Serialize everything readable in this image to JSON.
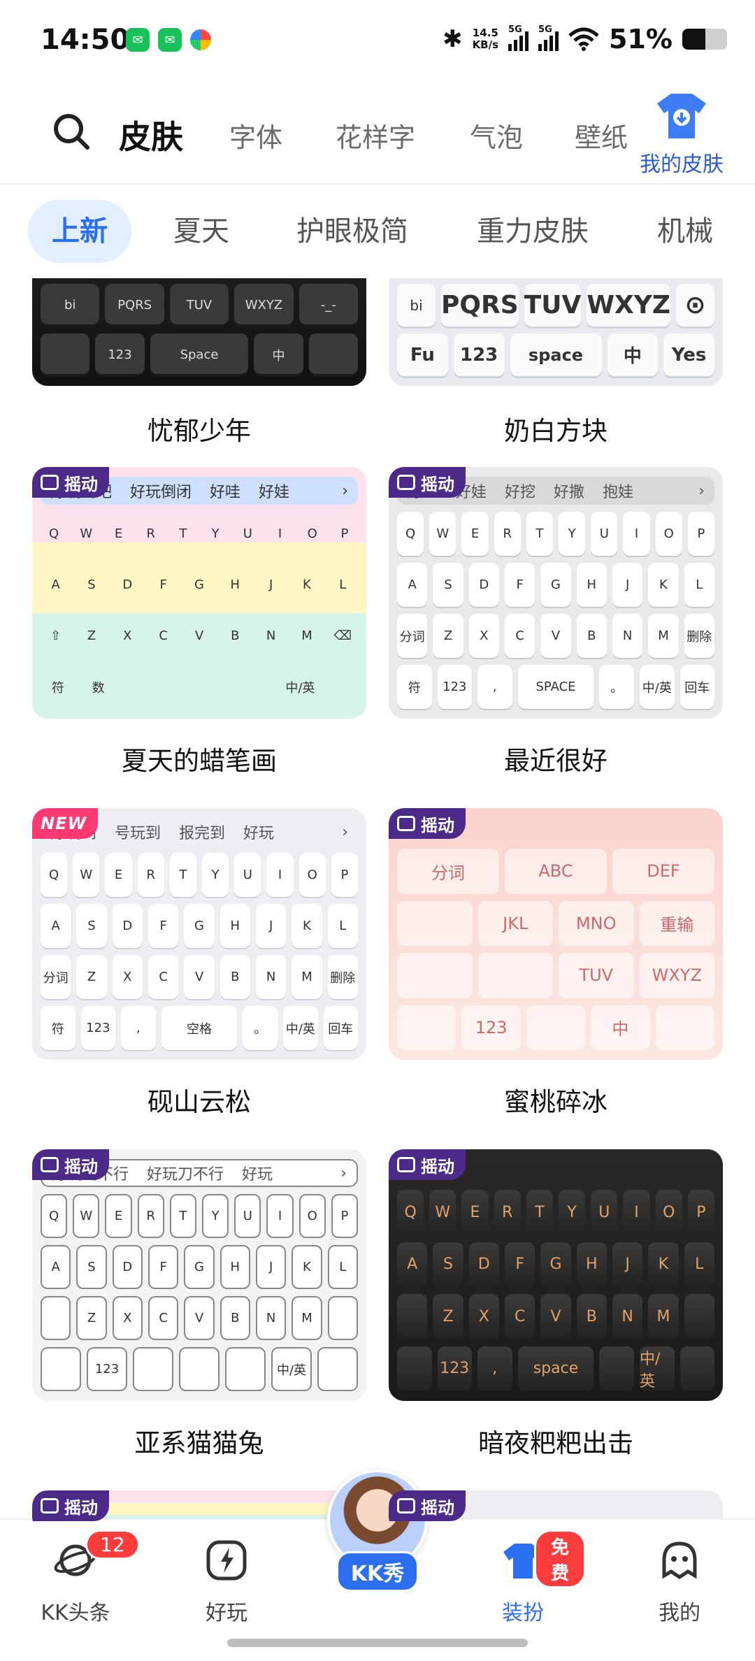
{
  "status_bar": {
    "time": "14:50",
    "app_icons": [
      "wechat-icon",
      "wechat-work-icon",
      "colorful-app-icon"
    ],
    "net_speed_value": "14.5",
    "net_speed_unit": "KB/s",
    "signal1_label": "5G",
    "signal2_label": "5G",
    "battery": "51%",
    "battery_level": 0.51
  },
  "top_tabs": [
    {
      "label": "皮肤",
      "active": true
    },
    {
      "label": "字体",
      "active": false
    },
    {
      "label": "花样字",
      "active": false
    },
    {
      "label": "气泡",
      "active": false
    },
    {
      "label": "壁纸",
      "active": false
    }
  ],
  "my_skin_label": "我的皮肤",
  "sub_tabs": [
    {
      "label": "上新",
      "active": true
    },
    {
      "label": "夏天",
      "active": false
    },
    {
      "label": "护眼极简",
      "active": false
    },
    {
      "label": "重力皮肤",
      "active": false
    },
    {
      "label": "机械",
      "active": false
    }
  ],
  "badges": {
    "shake": "摇动",
    "new": "NEW"
  },
  "cards": [
    {
      "title": "忧郁少年",
      "badge": "",
      "keys": [
        [
          "bi",
          "PQRS",
          "TUV",
          "WXYZ",
          "-_-"
        ],
        [
          "",
          "123",
          "Space",
          "中",
          ""
        ]
      ]
    },
    {
      "title": "奶白方块",
      "badge": "",
      "keys": [
        [
          "bi",
          "PQRS",
          "TUV",
          "WXYZ",
          "⊙"
        ],
        [
          "Fu",
          "123",
          "space",
          "中",
          "Yes"
        ]
      ]
    },
    {
      "title": "夏天的蜡笔画",
      "badge": "shake",
      "cands": [
        "好玩到吧",
        "好玩倒闭",
        "好哇",
        "好娃"
      ],
      "keys": [
        [
          "Q",
          "W",
          "E",
          "R",
          "T",
          "Y",
          "U",
          "I",
          "O",
          "P"
        ],
        [
          "A",
          "S",
          "D",
          "F",
          "G",
          "H",
          "J",
          "K",
          "L"
        ],
        [
          "⇧",
          "Z",
          "X",
          "C",
          "V",
          "B",
          "N",
          "M",
          "⌫"
        ],
        [
          "符",
          "数",
          "",
          "",
          "",
          "",
          "中/英",
          ""
        ]
      ]
    },
    {
      "title": "最近很好",
      "badge": "shake",
      "cands": [
        "好哇",
        "好娃",
        "好挖",
        "好撒",
        "抱娃"
      ],
      "keys": [
        [
          "Q",
          "W",
          "E",
          "R",
          "T",
          "Y",
          "U",
          "I",
          "O",
          "P"
        ],
        [
          "A",
          "S",
          "D",
          "F",
          "G",
          "H",
          "J",
          "K",
          "L"
        ],
        [
          "分词",
          "Z",
          "X",
          "C",
          "V",
          "B",
          "N",
          "M",
          "删除"
        ],
        [
          "符",
          "123",
          ",",
          "SPACE",
          "。",
          "中/英",
          "回车"
        ]
      ]
    },
    {
      "title": "砚山云松",
      "badge": "new",
      "cands": [
        "好玩到",
        "号玩到",
        "报完到",
        "好玩"
      ],
      "keys": [
        [
          "Q",
          "W",
          "E",
          "R",
          "T",
          "Y",
          "U",
          "I",
          "O",
          "P"
        ],
        [
          "A",
          "S",
          "D",
          "F",
          "G",
          "H",
          "J",
          "K",
          "L"
        ],
        [
          "分词",
          "Z",
          "X",
          "C",
          "V",
          "B",
          "N",
          "M",
          "删除"
        ],
        [
          "符",
          "123",
          ",",
          "空格",
          "。",
          "中/英",
          "回车"
        ]
      ]
    },
    {
      "title": "蜜桃碎冰",
      "badge": "shake",
      "keys": [
        [
          "分词",
          "ABC",
          "DEF"
        ],
        [
          "",
          "JKL",
          "MNO",
          "重输"
        ],
        [
          "",
          "",
          "TUV",
          "WXYZ"
        ],
        [
          "",
          "123",
          "",
          "中",
          ""
        ]
      ]
    },
    {
      "title": "亚系猫猫兔",
      "badge": "shake",
      "cands": [
        "好玩到不行",
        "好玩刀不行",
        "好玩"
      ],
      "keys": [
        [
          "Q",
          "W",
          "E",
          "R",
          "T",
          "Y",
          "U",
          "I",
          "O",
          "P"
        ],
        [
          "A",
          "S",
          "D",
          "F",
          "G",
          "H",
          "J",
          "K",
          "L"
        ],
        [
          "",
          "Z",
          "X",
          "C",
          "V",
          "B",
          "N",
          "M",
          ""
        ],
        [
          "",
          "123",
          "",
          "",
          "",
          "中/英",
          ""
        ]
      ]
    },
    {
      "title": "暗夜粑粑出击",
      "badge": "shake",
      "keys": [
        [
          "Q",
          "W",
          "E",
          "R",
          "T",
          "Y",
          "U",
          "I",
          "O",
          "P"
        ],
        [
          "A",
          "S",
          "D",
          "F",
          "G",
          "H",
          "J",
          "K",
          "L"
        ],
        [
          "",
          "Z",
          "X",
          "C",
          "V",
          "B",
          "N",
          "M",
          ""
        ],
        [
          "",
          "123",
          ",",
          "space",
          "",
          "中/英",
          ""
        ]
      ]
    }
  ],
  "bottom_nav": [
    {
      "label": "KK头条",
      "badge": "12",
      "icon": "planet-icon"
    },
    {
      "label": "好玩",
      "badge": "",
      "icon": "lightning-icon"
    },
    {
      "label": "KK秀",
      "badge": "",
      "icon": "avatar-icon"
    },
    {
      "label": "装扮",
      "badge": "免费",
      "icon": "tshirt-icon",
      "active": true
    },
    {
      "label": "我的",
      "badge": "",
      "icon": "ghost-face-icon"
    }
  ],
  "colors": {
    "accent": "#2b6ef0",
    "tab_highlight": "#ffd21f",
    "badge_shake": "#4b2a8a",
    "badge_new": "#ff3a72",
    "nav_badge": "#ff3b3b"
  }
}
